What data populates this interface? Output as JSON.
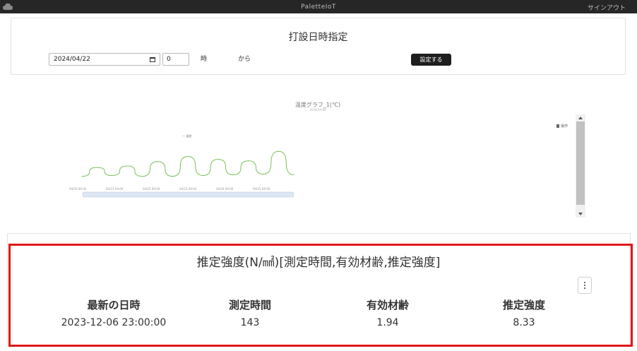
{
  "header": {
    "title": "PaletteIoT",
    "signout_label": "サインアウト",
    "logo_icon": "cloud-icon"
  },
  "date_panel": {
    "title": "打設日時指定",
    "date_value": "2024/04/22",
    "hour_value": "0",
    "hour_label": "時",
    "from_label": "から",
    "set_button_label": "設定する"
  },
  "chart": {
    "title": "温度グラフ_1(℃)",
    "subtitle": "2024-04-04",
    "legend_label": "温度",
    "menu_label": "操作",
    "tick_labels": [
      "04/20 09:00",
      "04/21 09:00",
      "04/22 09:00",
      "04/23 09:00",
      "04/24 09:00",
      "04/25 09:00"
    ],
    "line_color": "#7cc15a"
  },
  "chart_data": {
    "type": "line",
    "title": "温度グラフ_1(℃)",
    "x": [
      "04/20 09:00",
      "04/21 09:00",
      "04/22 09:00",
      "04/23 09:00",
      "04/24 09:00",
      "04/25 09:00"
    ],
    "series": [
      {
        "name": "温度",
        "values": [
          10,
          22,
          11,
          24,
          10,
          30,
          10,
          37,
          11,
          33,
          12,
          31,
          13,
          44,
          12
        ]
      }
    ],
    "grid": false
  },
  "strength_panel": {
    "title": "推定強度(N/㎟)[測定時間,有効材齢,推定強度]",
    "columns": [
      {
        "header": "最新の日時",
        "value": "2023-12-06 23:00:00"
      },
      {
        "header": "測定時間",
        "value": "143"
      },
      {
        "header": "有効材齢",
        "value": "1.94"
      },
      {
        "header": "推定強度",
        "value": "8.33"
      }
    ]
  }
}
